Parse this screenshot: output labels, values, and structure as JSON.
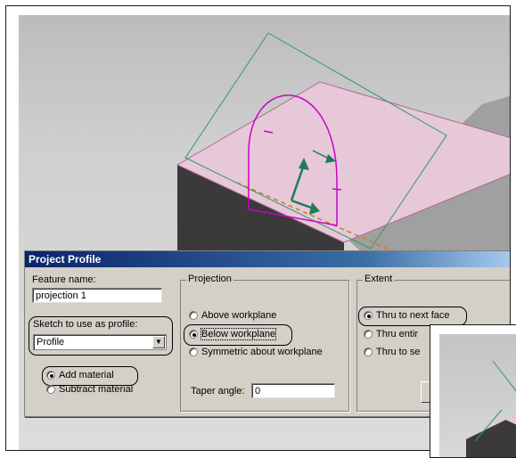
{
  "dialog": {
    "title": "Project Profile",
    "feature_name_label": "Feature name:",
    "feature_name_value": "projection 1",
    "sketch_label": "Sketch to use as profile:",
    "sketch_value": "Profile",
    "material_options": [
      "Add material",
      "Subtract material"
    ],
    "material_selected": "Add material",
    "projection": {
      "title": "Projection",
      "options": [
        "Above workplane",
        "Below workplane",
        "Symmetric about workplane"
      ],
      "selected": "Below workplane",
      "taper_label": "Taper angle:",
      "taper_value": "0"
    },
    "extent": {
      "title": "Extent",
      "options": [
        "Thru to next face",
        "Thru entir",
        "Thru to se"
      ],
      "selected": "Thru to next face"
    }
  },
  "colors": {
    "title_bar": "#0a246a",
    "top_face": "#e6c8d8",
    "side_dark": "#3a3a3a",
    "profile": "#cc00cc",
    "workplane": "#2a9a6a",
    "arrow": "#1f7a5a"
  },
  "icons": [
    "radio-icon",
    "dropdown-arrow-icon",
    "arrow-icon"
  ]
}
